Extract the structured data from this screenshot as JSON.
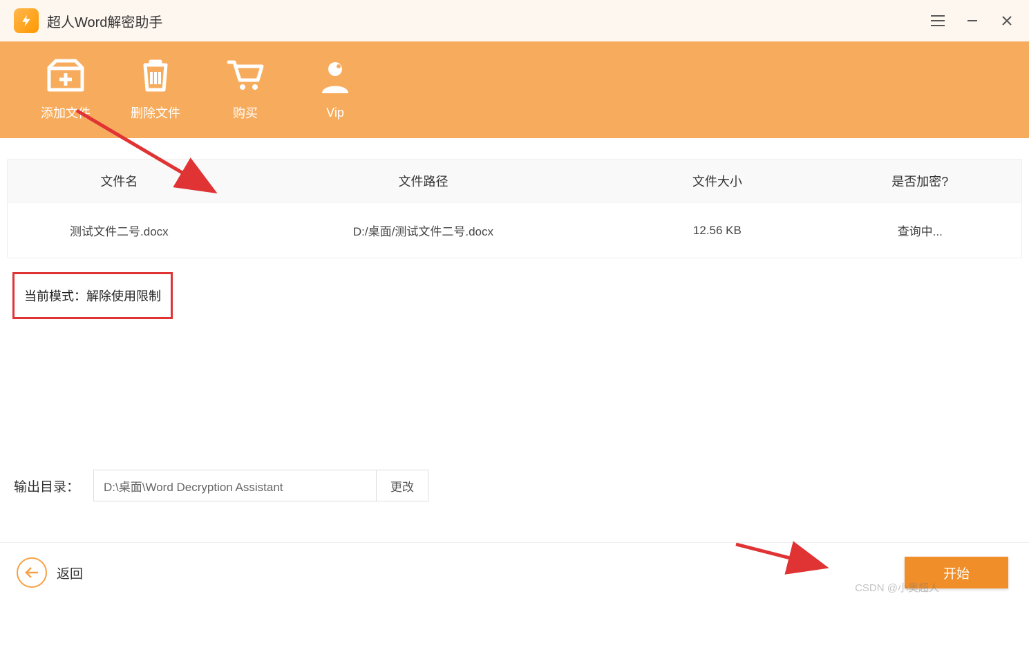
{
  "app": {
    "title": "超人Word解密助手"
  },
  "toolbar": {
    "add_file": "添加文件",
    "delete_file": "删除文件",
    "buy": "购买",
    "vip": "Vip"
  },
  "table": {
    "headers": {
      "name": "文件名",
      "path": "文件路径",
      "size": "文件大小",
      "encrypted": "是否加密?"
    },
    "rows": [
      {
        "name": "测试文件二号.docx",
        "path": "D:/桌面/测试文件二号.docx",
        "size": "12.56 KB",
        "encrypted": "查询中..."
      }
    ]
  },
  "mode": {
    "text": "当前模式：解除使用限制"
  },
  "output": {
    "label": "输出目录：",
    "value": "D:\\桌面\\Word Decryption Assistant",
    "change": "更改"
  },
  "footer": {
    "back": "返回",
    "start": "开始"
  },
  "watermark": "CSDN @小奥超人"
}
